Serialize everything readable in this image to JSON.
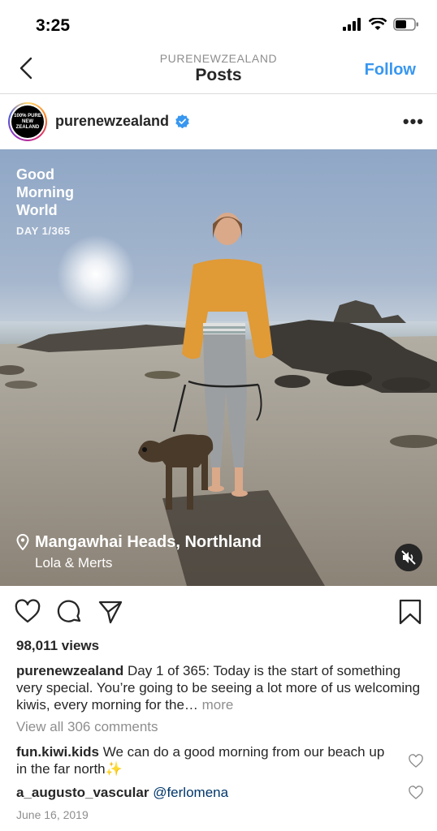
{
  "status": {
    "time": "3:25"
  },
  "nav": {
    "subtitle": "PURENEWZEALAND",
    "title": "Posts",
    "follow_label": "Follow"
  },
  "post": {
    "username": "purenewzealand",
    "avatar_text_line1": "100% PURE",
    "avatar_text_line2": "NEW ZEALAND",
    "overlay": {
      "title_line1": "Good",
      "title_line2": "Morning",
      "title_line3": "World",
      "day": "DAY 1/365",
      "location": "Mangawhai Heads, Northland",
      "people": "Lola & Merts"
    },
    "views": "98,011 views",
    "caption_user": "purenewzealand",
    "caption_text": "Day 1 of 365: Today is the start of something very special. You’re going to be seeing a lot more of us welcoming kiwis, every morning for the…",
    "caption_more": "more",
    "view_comments": "View all 306 comments",
    "comments": [
      {
        "user": "fun.kiwi.kids",
        "text": "We can do a good morning from our beach up in the far north✨"
      },
      {
        "user": "a_augusto_vascular",
        "mention": "@ferlomena"
      }
    ],
    "date": "June 16, 2019"
  },
  "colors": {
    "accent": "#3897f0",
    "verified": "#3897f0",
    "muted": "#8e8e8e"
  },
  "icons": [
    "chevron-left-icon",
    "verified-badge-icon",
    "more-options-icon",
    "location-pin-icon",
    "mute-icon",
    "heart-icon",
    "comment-icon",
    "share-icon",
    "bookmark-icon"
  ]
}
